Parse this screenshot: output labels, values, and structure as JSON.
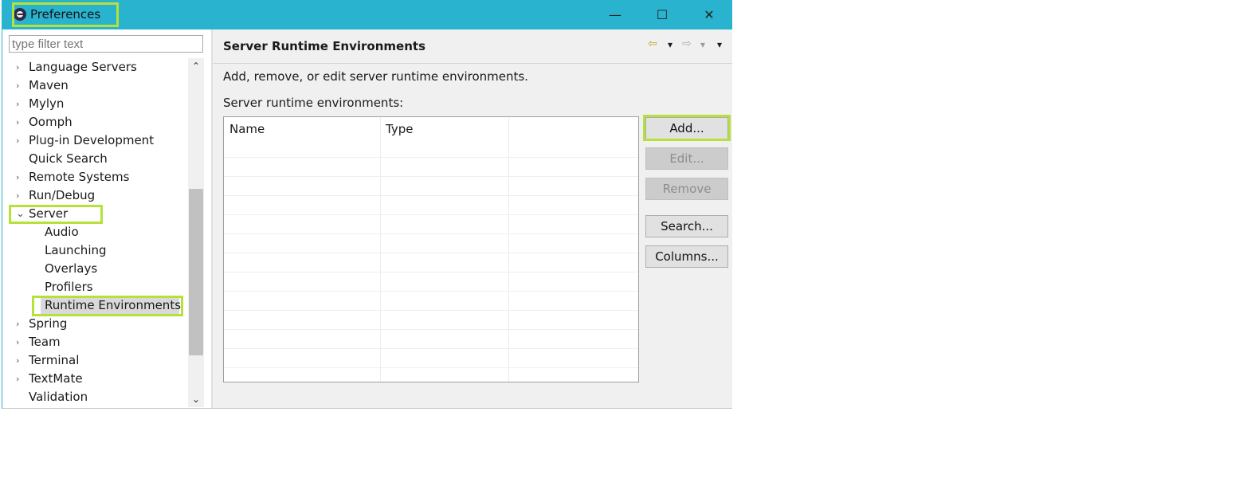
{
  "window": {
    "title": "Preferences",
    "minimize": "—",
    "maximize": "☐",
    "close": "✕",
    "titlebar_color": "#2ab3cf",
    "highlight_color": "#b6e13a"
  },
  "filter": {
    "placeholder": "type filter text"
  },
  "tree": {
    "items": [
      {
        "label": "Language Servers",
        "expander": "›"
      },
      {
        "label": "Maven",
        "expander": "›"
      },
      {
        "label": "Mylyn",
        "expander": "›"
      },
      {
        "label": "Oomph",
        "expander": "›"
      },
      {
        "label": "Plug-in Development",
        "expander": "›"
      },
      {
        "label": "Quick Search",
        "expander": ""
      },
      {
        "label": "Remote Systems",
        "expander": "›"
      },
      {
        "label": "Run/Debug",
        "expander": "›"
      },
      {
        "label": "Server",
        "expander": "⌄"
      },
      {
        "label": "Audio",
        "expander": ""
      },
      {
        "label": "Launching",
        "expander": ""
      },
      {
        "label": "Overlays",
        "expander": ""
      },
      {
        "label": "Profilers",
        "expander": ""
      },
      {
        "label": "Runtime Environments",
        "expander": ""
      },
      {
        "label": "Spring",
        "expander": "›"
      },
      {
        "label": "Team",
        "expander": "›"
      },
      {
        "label": "Terminal",
        "expander": "›"
      },
      {
        "label": "TextMate",
        "expander": "›"
      },
      {
        "label": "Validation",
        "expander": ""
      }
    ],
    "scroll_up": "⌃",
    "scroll_down": "⌄"
  },
  "page": {
    "title": "Server Runtime Environments",
    "description": "Add, remove, or edit server runtime environments.",
    "list_label": "Server runtime environments:",
    "nav": {
      "back": "⇦",
      "back_menu": "▾",
      "forward": "⇨",
      "forward_menu": "▾",
      "view_menu": "▾"
    }
  },
  "table": {
    "columns": [
      "Name",
      "Type",
      ""
    ],
    "rows": []
  },
  "buttons": {
    "add": "Add...",
    "edit": "Edit...",
    "remove": "Remove",
    "search": "Search...",
    "columns": "Columns..."
  }
}
